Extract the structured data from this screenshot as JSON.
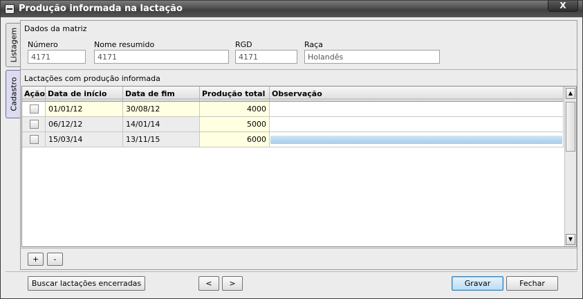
{
  "window": {
    "title": "Produção informada na lactação",
    "close_label": "X"
  },
  "side_tabs": {
    "listagem": "Listagem",
    "cadastro": "Cadastro"
  },
  "matriz": {
    "section_label": "Dados da matriz",
    "numero": {
      "label": "Número",
      "value": "4171"
    },
    "nome_resumido": {
      "label": "Nome resumido",
      "value": "4171"
    },
    "rgd": {
      "label": "RGD",
      "value": "4171"
    },
    "raca": {
      "label": "Raça",
      "value": "Holandês"
    }
  },
  "lactacoes": {
    "section_label": "Lactações com produção informada",
    "columns": [
      "Ação",
      "Data de início",
      "Data de fim",
      "Produção total",
      "Observação"
    ],
    "rows": [
      {
        "data_inicio": "01/01/12",
        "data_fim": "30/08/12",
        "producao_total": "4000",
        "observacao": ""
      },
      {
        "data_inicio": "06/12/12",
        "data_fim": "14/01/14",
        "producao_total": "5000",
        "observacao": ""
      },
      {
        "data_inicio": "15/03/14",
        "data_fim": "13/11/15",
        "producao_total": "6000",
        "observacao": ""
      }
    ],
    "add_label": "+",
    "remove_label": "-"
  },
  "footer": {
    "buscar_label": "Buscar lactações encerradas",
    "prev_label": "<",
    "next_label": ">",
    "gravar_label": "Gravar",
    "fechar_label": "Fechar"
  },
  "colors": {
    "accent": "#b9ddf5",
    "highlight_cell": "#ffffe1",
    "selected_row": "#a6cde9"
  }
}
